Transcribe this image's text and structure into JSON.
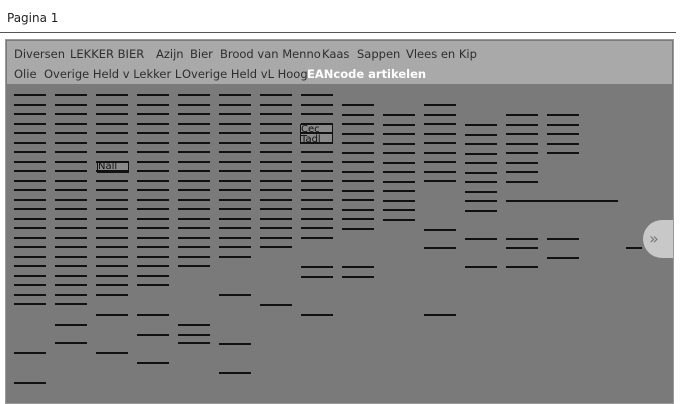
{
  "page": {
    "title": "Pagina 1"
  },
  "tabs": [
    {
      "label": "Diversen"
    },
    {
      "label": "LEKKER BIER"
    },
    {
      "label": "Azijn"
    },
    {
      "label": "Bier"
    },
    {
      "label": "Brood van Menno"
    },
    {
      "label": "Kaas"
    },
    {
      "label": "Sappen"
    },
    {
      "label": "Vlees en Kip"
    },
    {
      "label": "Olie"
    },
    {
      "label": "Overige Held v Lekker L"
    },
    {
      "label": "Overige Held vL Hoog"
    },
    {
      "label": "EANcode artikelen",
      "active": true
    }
  ],
  "barcode_labels": [
    "Nall",
    "Cec Tadl"
  ],
  "colors": {
    "panel_bg": "#7a7a7a",
    "tabbar_bg": "#a9a9a9",
    "active_tab_text": "#ffffff",
    "bar_color": "#111111"
  },
  "nav": {
    "icon": "double-chevron-right-icon",
    "glyph": "»"
  }
}
